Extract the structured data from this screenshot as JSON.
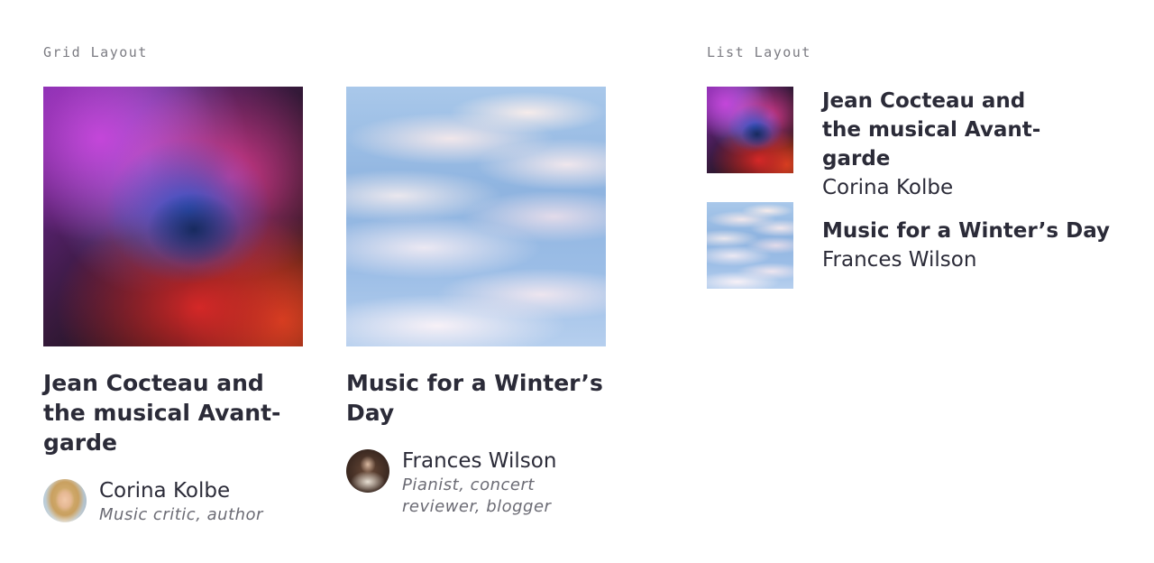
{
  "grid": {
    "label": "Grid Layout",
    "cards": [
      {
        "title": "Jean Cocteau and the musical Avant-garde",
        "author_name": "Corina Kolbe",
        "author_role": "Music critic, author"
      },
      {
        "title": "Music for a Winter’s Day",
        "author_name": "Frances Wilson",
        "author_role": "Pianist, concert reviewer, blogger"
      }
    ]
  },
  "list": {
    "label": "List Layout",
    "items": [
      {
        "title": "Jean Cocteau and the musical Avant-garde",
        "author_name": "Corina Kolbe"
      },
      {
        "title": "Music for a Winter’s Day",
        "author_name": "Frances Wilson"
      }
    ]
  },
  "colors": {
    "text": "#2b2b38",
    "muted": "#6b6b74",
    "label": "#7b7b82",
    "background": "#ffffff"
  }
}
